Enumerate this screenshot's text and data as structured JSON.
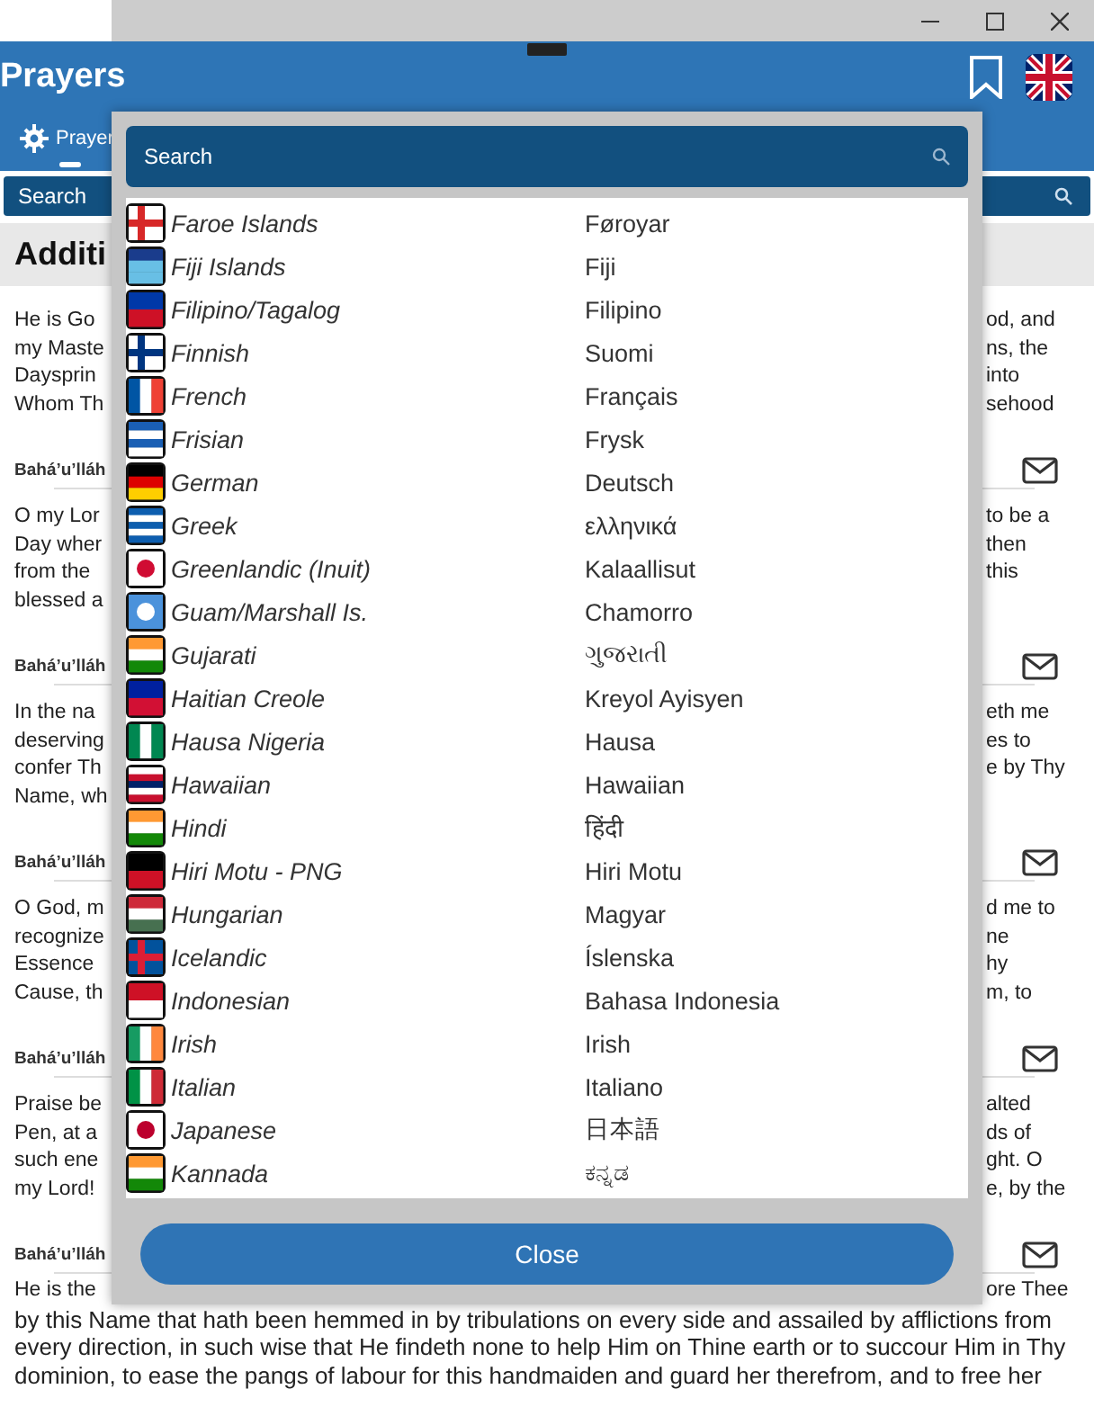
{
  "header": {
    "title": "Prayers"
  },
  "tabs": [
    {
      "label": "Prayer",
      "selected": true
    }
  ],
  "search": {
    "placeholder": "Search"
  },
  "heading": "Additi",
  "prayers": [
    {
      "left_lines": [
        "He is Go",
        "my Maste",
        "Daysprin",
        "Whom Th"
      ],
      "right_lines": [
        "od, and",
        "ns, the",
        "into",
        "sehood"
      ],
      "author": "Bahá’u’lláh"
    },
    {
      "left_lines": [
        "O my Lor",
        "Day wher",
        "from the",
        "blessed a"
      ],
      "right_lines": [
        "to be a",
        "then",
        "this"
      ],
      "author": "Bahá’u’lláh"
    },
    {
      "left_lines": [
        "In the na",
        "deserving",
        "confer Th",
        "Name, wh"
      ],
      "right_lines": [
        "eth me",
        "es to",
        "e by Thy"
      ],
      "author": "Bahá’u’lláh"
    },
    {
      "left_lines": [
        "O God, m",
        "recognize",
        "Essence",
        "Cause, th"
      ],
      "right_lines": [
        "d me to",
        "ne",
        "hy",
        "m, to"
      ],
      "author": "Bahá’u’lláh"
    },
    {
      "left_lines": [
        "Praise be",
        "Pen, at a",
        "such ene",
        "my Lord!"
      ],
      "right_lines": [
        "alted",
        "ds of",
        "ght. O",
        "e, by the"
      ],
      "author": "Bahá’u’lláh"
    }
  ],
  "last_prayer": {
    "left_first": "He is the",
    "right_first": "ore Thee",
    "text": "by this Name that hath been hemmed in by tribulations on every side and assailed by afflictions from every direction, in such wise that He findeth none to help Him on Thine earth or to succour Him in Thy dominion, to ease the pangs of labour for this handmaiden and guard her therefrom, and to free her"
  },
  "dialog": {
    "search": {
      "placeholder": "Search"
    },
    "languages": [
      {
        "name": "Faroe Islands",
        "native": "Føroyar"
      },
      {
        "name": "Fiji Islands",
        "native": "Fiji"
      },
      {
        "name": "Filipino/Tagalog",
        "native": "Filipino"
      },
      {
        "name": "Finnish",
        "native": "Suomi"
      },
      {
        "name": "French",
        "native": "Français"
      },
      {
        "name": "Frisian",
        "native": "Frysk"
      },
      {
        "name": "German",
        "native": "Deutsch"
      },
      {
        "name": "Greek",
        "native": "ελληνικά"
      },
      {
        "name": "Greenlandic (Inuit)",
        "native": "Kalaallisut"
      },
      {
        "name": "Guam/Marshall Is.",
        "native": "Chamorro"
      },
      {
        "name": "Gujarati",
        "native": "ગુજરાતી"
      },
      {
        "name": "Haitian Creole",
        "native": "Kreyol Ayisyen"
      },
      {
        "name": "Hausa Nigeria",
        "native": "Hausa"
      },
      {
        "name": "Hawaiian",
        "native": "Hawaiian"
      },
      {
        "name": "Hindi",
        "native": "हिंदी"
      },
      {
        "name": "Hiri Motu - PNG",
        "native": "Hiri Motu"
      },
      {
        "name": "Hungarian",
        "native": "Magyar"
      },
      {
        "name": "Icelandic",
        "native": "Íslenska"
      },
      {
        "name": "Indonesian",
        "native": "Bahasa Indonesia"
      },
      {
        "name": "Irish",
        "native": "Irish"
      },
      {
        "name": "Italian",
        "native": "Italiano"
      },
      {
        "name": "Japanese",
        "native": "日本語"
      },
      {
        "name": "Kannada",
        "native": "ಕನ್ನಡ"
      }
    ],
    "close_button": "Close"
  }
}
